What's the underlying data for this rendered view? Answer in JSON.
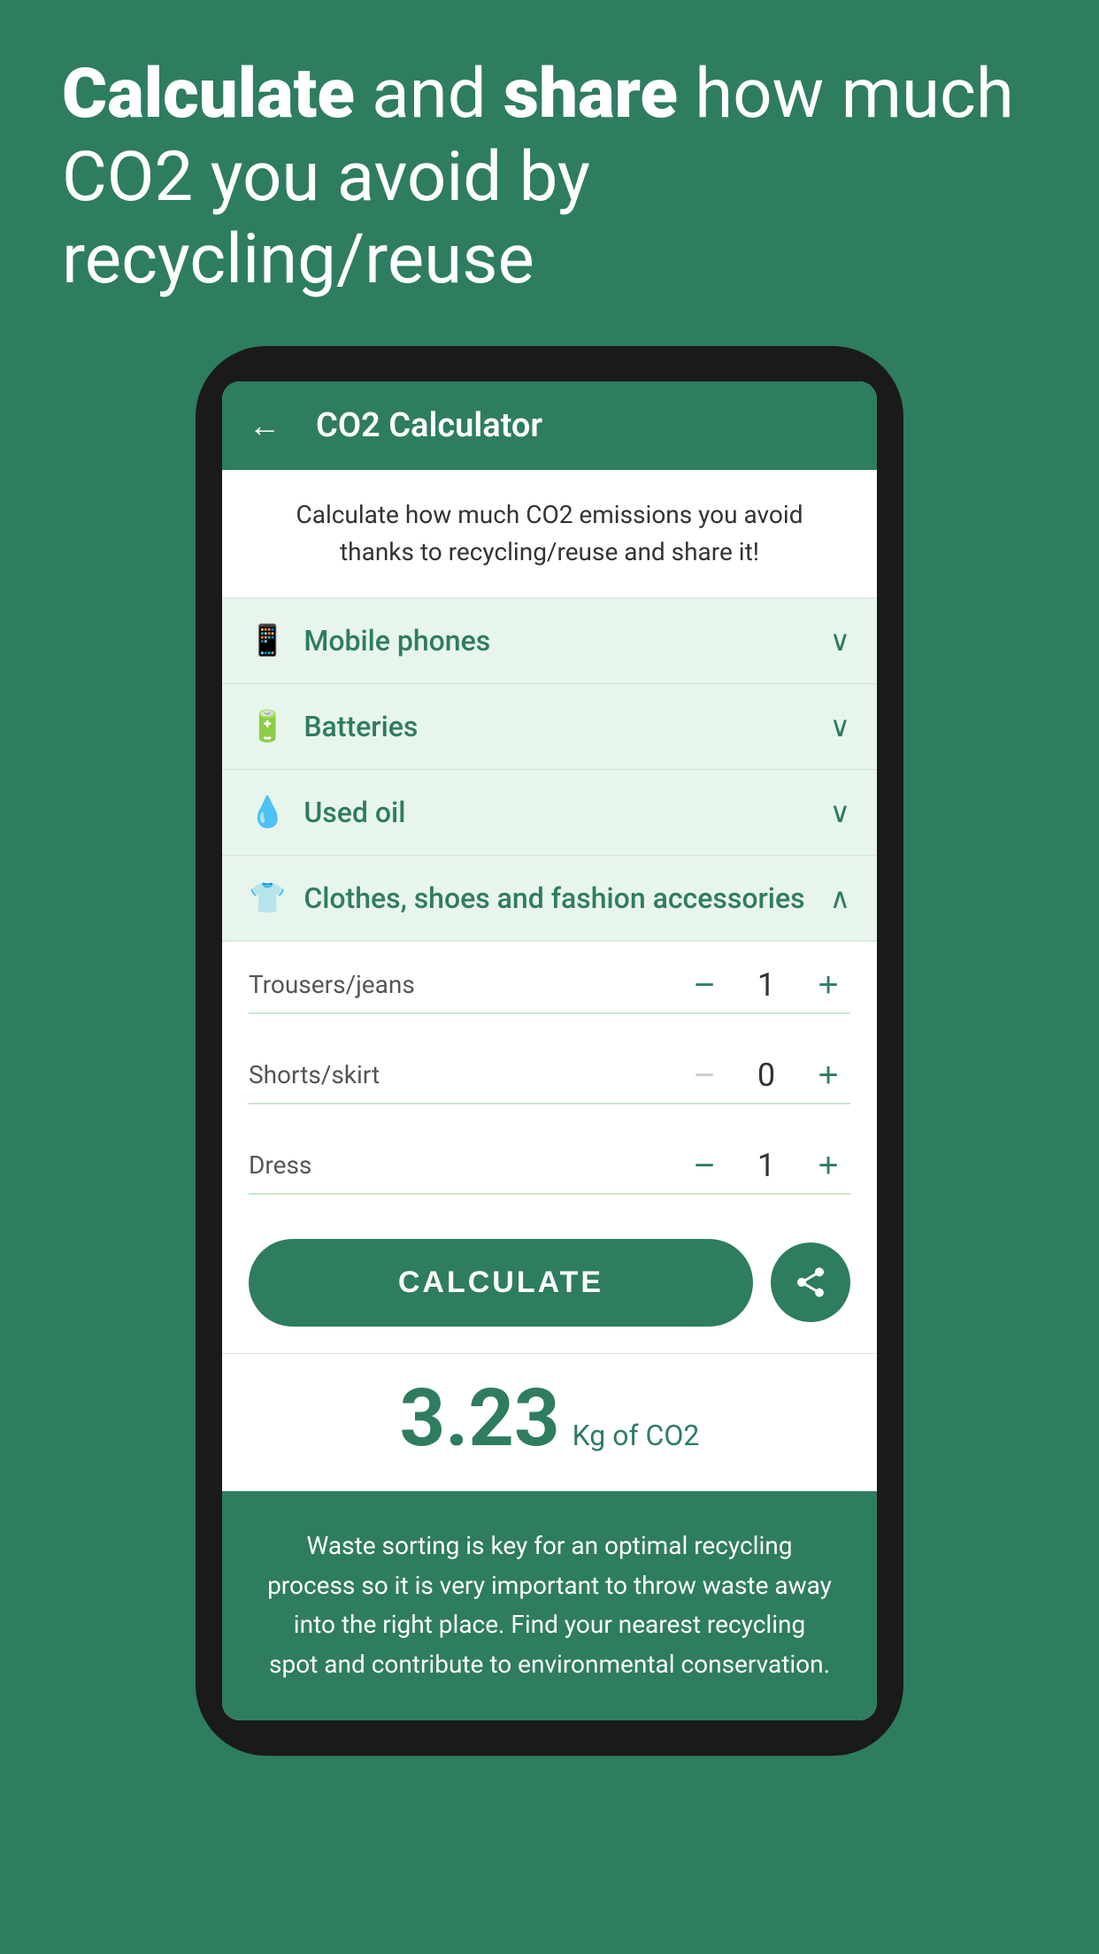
{
  "hero": {
    "line1_part1": "Calculate",
    "line1_connector": " and ",
    "line1_part2": "share",
    "line1_end": " how much",
    "line2": "CO2 you avoid by recycling/reuse"
  },
  "appbar": {
    "title": "CO2 Calculator",
    "back_label": "←"
  },
  "description": "Calculate how much CO2 emissions you avoid thanks to recycling/reuse and share it!",
  "categories": [
    {
      "id": "mobile_phones",
      "icon": "📱",
      "label": "Mobile phones",
      "expanded": false
    },
    {
      "id": "batteries",
      "icon": "🔋",
      "label": "Batteries",
      "expanded": false
    },
    {
      "id": "used_oil",
      "icon": "💧",
      "label": "Used oil",
      "expanded": false
    }
  ],
  "expanded_category": {
    "icon": "👕",
    "label": "Clothes, shoes and fashion accessories"
  },
  "counters": [
    {
      "id": "trousers",
      "label": "Trousers/jeans",
      "value": "1"
    },
    {
      "id": "shorts",
      "label": "Shorts/skirt",
      "value": "0"
    },
    {
      "id": "dress",
      "label": "Dress",
      "value": "1"
    }
  ],
  "buttons": {
    "calculate": "CALCULATE",
    "share_icon": "⋖"
  },
  "result": {
    "value": "3.23",
    "unit": "Kg of CO2"
  },
  "footer": "Waste sorting is key for an optimal recycling process so it is very important to throw waste away into the right place. Find your nearest recycling spot and contribute to environmental conservation."
}
